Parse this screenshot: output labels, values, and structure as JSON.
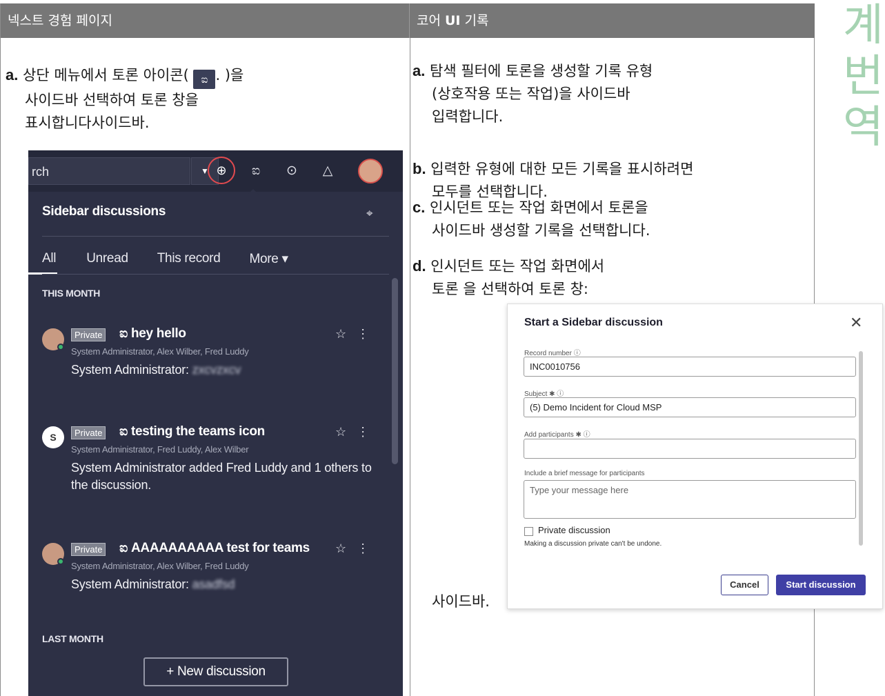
{
  "header": {
    "left_title": "넥스트 경험 페이지",
    "right_title_prefix": "코어 ",
    "right_title_bold": "UI",
    "right_title_suffix": " 기록"
  },
  "watermark": "계번역",
  "left_steps": {
    "a": {
      "marker": "a.",
      "line1_pre": "상단 메뉴에서 토론 아이콘(",
      "icon_glyph": "ಐ",
      "line1_post": ". )을",
      "line2": "사이드바 선택하여 토론 창을",
      "line3": "표시합니다사이드바."
    }
  },
  "right_steps": {
    "a": {
      "marker": "a.",
      "lines": [
        "탐색 필터에 토론을 생성할 기록 유형",
        "(상호작용 또는 작업)을 사이드바",
        "입력합니다."
      ]
    },
    "b": {
      "marker": "b.",
      "lines": [
        "입력한 유형에 대한 모든 기록을 표시하려면",
        "모두를 선택합니다."
      ]
    },
    "c": {
      "marker": "c.",
      "lines": [
        "인시던트 또는 작업 화면에서 토론을",
        "사이드바 생성할 기록을 선택합니다."
      ]
    },
    "d": {
      "marker": "d.",
      "lines": [
        "인시던트 또는 작업 화면에서",
        "토론 을 선택하여 토론 창:"
      ]
    },
    "trailing": "사이드바."
  },
  "sidebar_panel": {
    "search_text": "rch",
    "panel_title": "Sidebar discussions",
    "tabs": [
      "All",
      "Unread",
      "This record",
      "More ▾"
    ],
    "section_this_month": "THIS MONTH",
    "section_last_month": "LAST MONTH",
    "discussions": [
      {
        "badge": "Private",
        "topic": "ಐ hey hello",
        "participants": "System Administrator, Alex Wilber, Fred Luddy",
        "message": "System Administrator: ",
        "message_blur": "zxcvzxcv"
      },
      {
        "avatar_letter": "S",
        "badge": "Private",
        "topic": "ಐ testing the teams icon",
        "participants": "System Administrator, Fred Luddy, Alex Wilber",
        "message": "System Administrator added Fred Luddy and 1 others to the discussion.",
        "message_blur": ""
      },
      {
        "badge": "Private",
        "topic": "ಐ AAAAAAAAAA test for teams",
        "participants": "System Administrator, Alex Wilber, Fred Luddy",
        "message": "System Administrator: ",
        "message_blur": "asadfsd"
      }
    ],
    "new_discussion_button": "+ New discussion"
  },
  "dialog": {
    "title": "Start a Sidebar discussion",
    "record_number_label": "Record number ⓘ",
    "record_number_value": "INC0010756",
    "subject_label": "Subject ✱ ⓘ",
    "subject_value": "(5) Demo Incident for Cloud MSP",
    "participants_label": "Add participants ✱ ⓘ",
    "participants_value": "",
    "message_label": "Include a brief message for participants",
    "message_placeholder": "Type your message here",
    "private_label": "Private discussion",
    "private_help": "Making a discussion private can't be undone.",
    "cancel_label": "Cancel",
    "start_label": "Start discussion"
  },
  "colors": {
    "header_bg": "#777777",
    "panel_bg": "#2d3045",
    "accent_red": "#e24a4f",
    "primary_button": "#3f3fa5",
    "watermark": "#a6d3b2"
  }
}
